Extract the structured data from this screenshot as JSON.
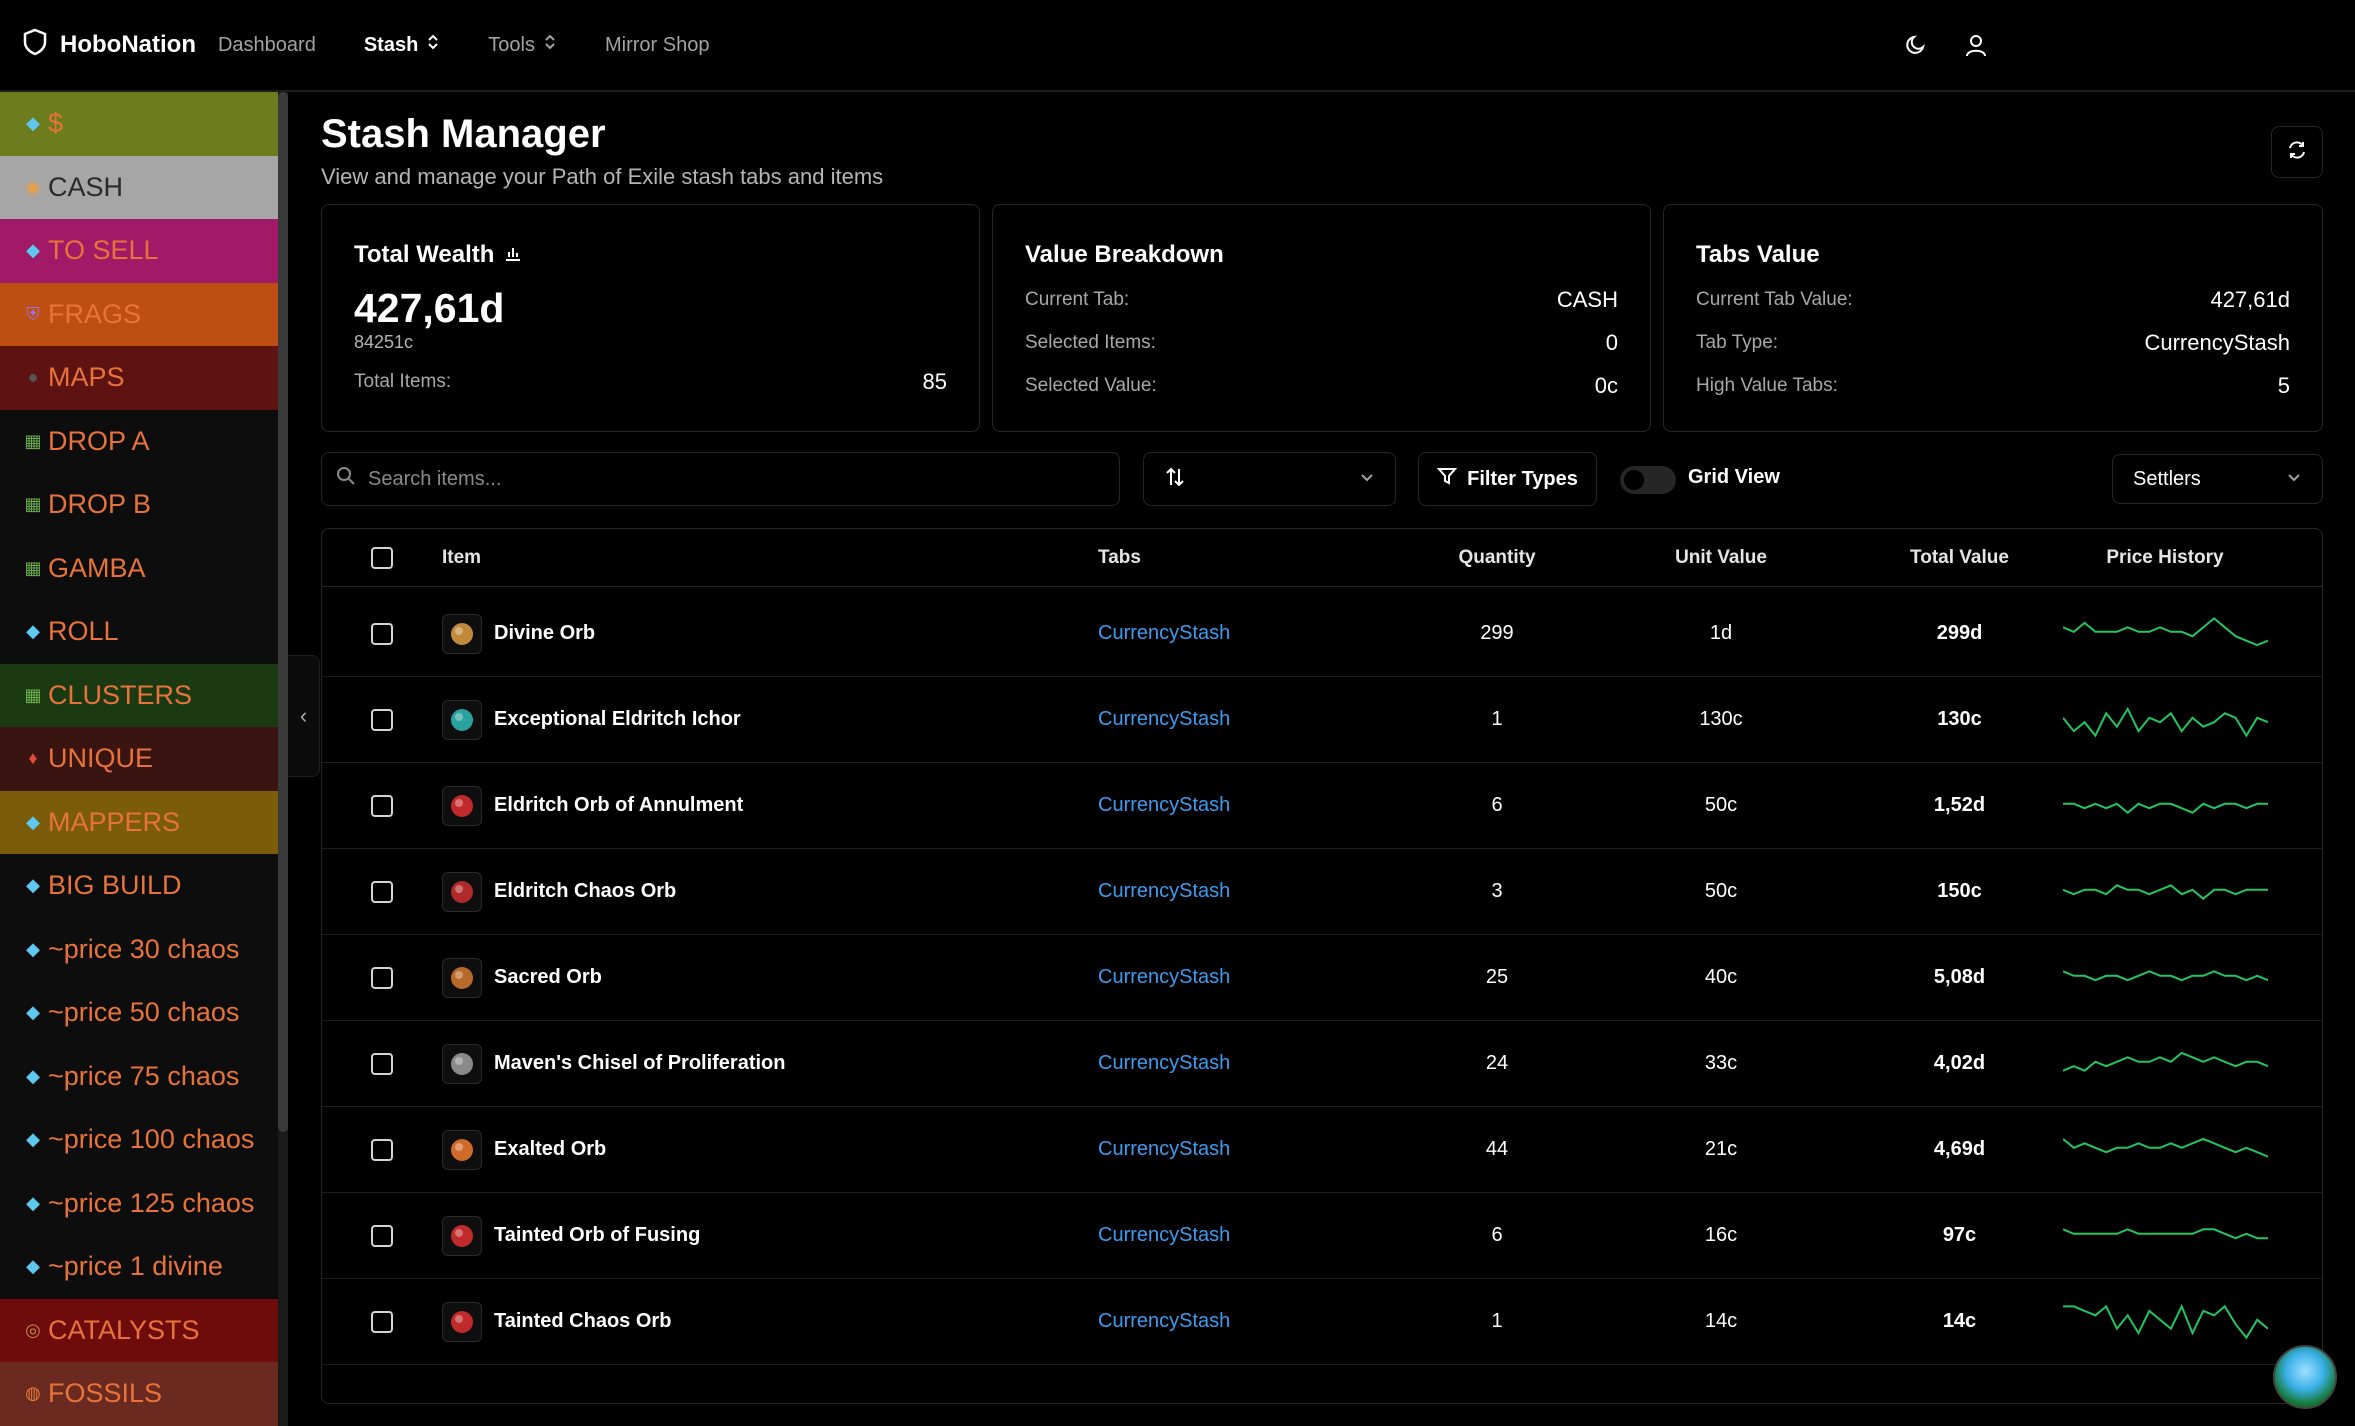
{
  "nav": {
    "brand": "HoboNation",
    "links": [
      "Dashboard",
      "Stash",
      "Tools",
      "Mirror Shop"
    ]
  },
  "sidebar": {
    "tabs": [
      {
        "label": "$",
        "bg": "#6d7c1d",
        "color": "#e8733a",
        "icon": "gem-icon"
      },
      {
        "label": "CASH",
        "bg": "#a6a6a6",
        "color": "#2a2a2a",
        "icon": "coin-icon"
      },
      {
        "label": "TO SELL",
        "bg": "#a01a68",
        "color": "#e8733a",
        "icon": "gem-icon"
      },
      {
        "label": "FRAGS",
        "bg": "#bd4f12",
        "color": "#e8733a",
        "icon": "shield-icon"
      },
      {
        "label": "MAPS",
        "bg": "#5e1212",
        "color": "#e8733a",
        "icon": "map-icon"
      },
      {
        "label": "DROP A",
        "bg": "#0d0d0d",
        "color": "#e8733a",
        "icon": "grid-icon"
      },
      {
        "label": "DROP B",
        "bg": "#0d0d0d",
        "color": "#e8733a",
        "icon": "grid-icon"
      },
      {
        "label": "GAMBA",
        "bg": "#0d0d0d",
        "color": "#e8733a",
        "icon": "grid-icon"
      },
      {
        "label": "ROLL",
        "bg": "#0d0d0d",
        "color": "#e8733a",
        "icon": "gem-icon"
      },
      {
        "label": "CLUSTERS",
        "bg": "#1c3a12",
        "color": "#e8733a",
        "icon": "grid-icon"
      },
      {
        "label": "UNIQUE",
        "bg": "#3a1410",
        "color": "#e8733a",
        "icon": "unique-icon"
      },
      {
        "label": "MAPPERS",
        "bg": "#7a5c0a",
        "color": "#e8733a",
        "icon": "gem-icon"
      },
      {
        "label": "BIG BUILD",
        "bg": "#0d0d0d",
        "color": "#e8733a",
        "icon": "gem-icon"
      },
      {
        "label": "~price 30 chaos",
        "bg": "#0d0d0d",
        "color": "#e8733a",
        "icon": "gem-icon"
      },
      {
        "label": "~price 50 chaos",
        "bg": "#0d0d0d",
        "color": "#e8733a",
        "icon": "gem-icon"
      },
      {
        "label": "~price 75 chaos",
        "bg": "#0d0d0d",
        "color": "#e8733a",
        "icon": "gem-icon"
      },
      {
        "label": "~price 100 chaos",
        "bg": "#0d0d0d",
        "color": "#e8733a",
        "icon": "gem-icon"
      },
      {
        "label": "~price 125 chaos",
        "bg": "#0d0d0d",
        "color": "#e8733a",
        "icon": "gem-icon"
      },
      {
        "label": "~price 1 divine",
        "bg": "#0d0d0d",
        "color": "#e8733a",
        "icon": "gem-icon"
      },
      {
        "label": "CATALYSTS",
        "bg": "#6e0c0c",
        "color": "#e8733a",
        "icon": "catalyst-icon"
      },
      {
        "label": "FOSSILS",
        "bg": "#6a2a20",
        "color": "#e8733a",
        "icon": "fossil-icon"
      }
    ]
  },
  "page": {
    "title": "Stash Manager",
    "subtitle": "View and manage your Path of Exile stash tabs and items"
  },
  "wealth": {
    "title": "Total Wealth",
    "value": "427,61d",
    "chaos": "84251c",
    "items_label": "Total Items:",
    "items": "85"
  },
  "breakdown": {
    "title": "Value Breakdown",
    "rows": [
      {
        "label": "Current Tab:",
        "value": "CASH"
      },
      {
        "label": "Selected Items:",
        "value": "0"
      },
      {
        "label": "Selected Value:",
        "value": "0c"
      }
    ]
  },
  "tabsvalue": {
    "title": "Tabs Value",
    "rows": [
      {
        "label": "Current Tab Value:",
        "value": "427,61d"
      },
      {
        "label": "Tab Type:",
        "value": "CurrencyStash"
      },
      {
        "label": "High Value Tabs:",
        "value": "5"
      }
    ]
  },
  "toolbar": {
    "search_placeholder": "Search items...",
    "filter_label": "Filter Types",
    "grid_label": "Grid View",
    "league": "Settlers"
  },
  "table": {
    "headers": [
      "Item",
      "Tabs",
      "Quantity",
      "Unit Value",
      "Total Value",
      "Price History"
    ],
    "rows": [
      {
        "item": "Divine Orb",
        "tab": "CurrencyStash",
        "qty": "299",
        "unit": "1d",
        "total": "299d",
        "icon": "#c08a3a",
        "spark": [
          6,
          5,
          7,
          5,
          5,
          5,
          6,
          5,
          5,
          6,
          5,
          5,
          4,
          6,
          8,
          6,
          4,
          3,
          2,
          3
        ]
      },
      {
        "item": "Exceptional Eldritch Ichor",
        "tab": "CurrencyStash",
        "qty": "1",
        "unit": "130c",
        "total": "130c",
        "icon": "#2aa3a0",
        "spark": [
          5,
          2,
          4,
          1,
          6,
          3,
          7,
          2,
          5,
          4,
          6,
          2,
          5,
          3,
          4,
          6,
          5,
          1,
          5,
          4
        ]
      },
      {
        "item": "Eldritch Orb of Annulment",
        "tab": "CurrencyStash",
        "qty": "6",
        "unit": "50c",
        "total": "1,52d",
        "icon": "#c02a2a",
        "spark": [
          5,
          5,
          4,
          5,
          4,
          5,
          3,
          5,
          4,
          5,
          5,
          4,
          3,
          5,
          4,
          5,
          5,
          4,
          5,
          5
        ]
      },
      {
        "item": "Eldritch Chaos Orb",
        "tab": "CurrencyStash",
        "qty": "3",
        "unit": "50c",
        "total": "150c",
        "icon": "#b02a2a",
        "spark": [
          5,
          4,
          5,
          5,
          4,
          6,
          5,
          5,
          4,
          5,
          6,
          4,
          5,
          3,
          5,
          5,
          4,
          5,
          5,
          5
        ]
      },
      {
        "item": "Sacred Orb",
        "tab": "CurrencyStash",
        "qty": "25",
        "unit": "40c",
        "total": "5,08d",
        "icon": "#b86a2a",
        "spark": [
          6,
          5,
          5,
          4,
          5,
          5,
          4,
          5,
          6,
          5,
          5,
          4,
          5,
          5,
          6,
          5,
          5,
          4,
          5,
          4
        ]
      },
      {
        "item": "Maven's Chisel of Proliferation",
        "tab": "CurrencyStash",
        "qty": "24",
        "unit": "33c",
        "total": "4,02d",
        "icon": "#8a8a8a",
        "spark": [
          3,
          4,
          3,
          5,
          4,
          5,
          6,
          5,
          5,
          6,
          5,
          7,
          6,
          5,
          6,
          5,
          4,
          5,
          5,
          4
        ]
      },
      {
        "item": "Exalted Orb",
        "tab": "CurrencyStash",
        "qty": "44",
        "unit": "21c",
        "total": "4,69d",
        "icon": "#d06a2a",
        "spark": [
          7,
          5,
          6,
          5,
          4,
          5,
          5,
          6,
          5,
          5,
          6,
          5,
          6,
          7,
          6,
          5,
          4,
          5,
          4,
          3
        ]
      },
      {
        "item": "Tainted Orb of Fusing",
        "tab": "CurrencyStash",
        "qty": "6",
        "unit": "16c",
        "total": "97c",
        "icon": "#c02a2a",
        "spark": [
          6,
          5,
          5,
          5,
          5,
          5,
          6,
          5,
          5,
          5,
          5,
          5,
          5,
          6,
          6,
          5,
          4,
          5,
          4,
          4
        ]
      },
      {
        "item": "Tainted Chaos Orb",
        "tab": "CurrencyStash",
        "qty": "1",
        "unit": "14c",
        "total": "14c",
        "icon": "#c02a2a",
        "spark": [
          8,
          8,
          7,
          6,
          8,
          3,
          6,
          2,
          7,
          5,
          3,
          8,
          2,
          7,
          6,
          8,
          4,
          1,
          5,
          3
        ]
      }
    ]
  }
}
